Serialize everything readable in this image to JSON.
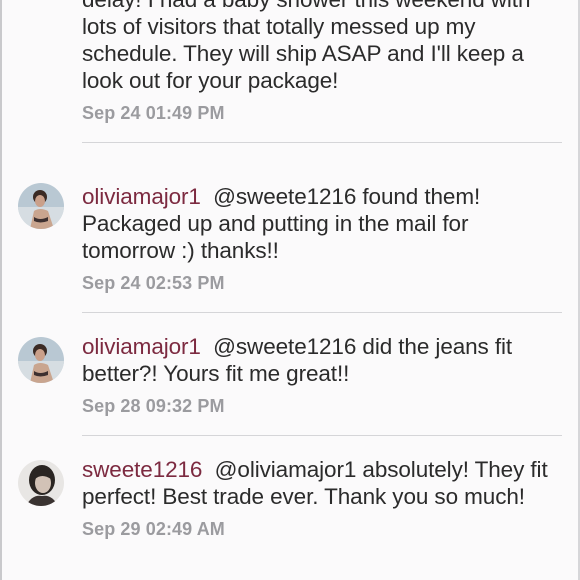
{
  "comments": [
    {
      "user": "",
      "text": "delay! I had a baby shower this weekend with lots of visitors that totally messed up my schedule. They will ship ASAP and I'll keep a look out for your package!",
      "time": "Sep 24 01:49 PM",
      "avatar": "none"
    },
    {
      "user": "oliviamajor1",
      "text": "@sweete1216 found them! Packaged up and putting in the mail for tomorrow :) thanks!!",
      "time": "Sep 24 02:53 PM",
      "avatar": "avatar-beach-photo"
    },
    {
      "user": "oliviamajor1",
      "text": "@sweete1216 did the jeans fit better?! Yours fit me great!!",
      "time": "Sep 28 09:32 PM",
      "avatar": "avatar-beach-photo"
    },
    {
      "user": "sweete1216",
      "text": "@oliviamajor1 absolutely! They fit perfect! Best trade ever. Thank you so much!",
      "time": "Sep 29 02:49 AM",
      "avatar": "avatar-portrait-photo"
    }
  ],
  "colors": {
    "background": "#fbfafb",
    "username": "#7c2a40",
    "text": "#2b2b2b",
    "timestamp": "#9b9b9f",
    "divider": "#d5d5d8"
  }
}
